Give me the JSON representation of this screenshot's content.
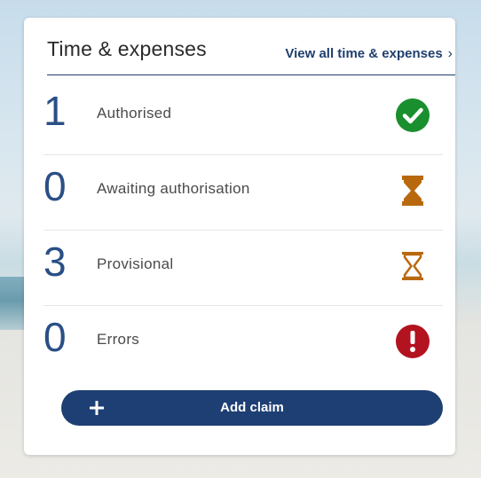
{
  "widget": {
    "title": "Time & expenses",
    "view_all_label": "View all time & expenses",
    "rows": [
      {
        "count": "1",
        "label": "Authorised",
        "icon": "check-circle-icon",
        "color": "#1a8f2e"
      },
      {
        "count": "0",
        "label": "Awaiting authorisation",
        "icon": "hourglass-filled-icon",
        "color": "#b8690e"
      },
      {
        "count": "3",
        "label": "Provisional",
        "icon": "hourglass-outline-icon",
        "color": "#b8690e"
      },
      {
        "count": "0",
        "label": "Errors",
        "icon": "alert-circle-icon",
        "color": "#b3121f"
      }
    ],
    "add_button_label": "Add claim",
    "accent_color": "#1e3f73"
  }
}
